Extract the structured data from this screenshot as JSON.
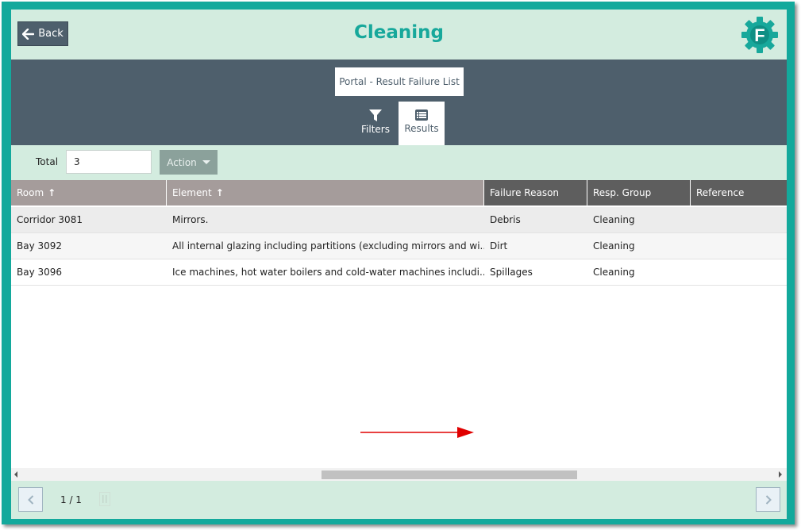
{
  "header": {
    "back_label": "Back",
    "title": "Cleaning",
    "logo_letter": "F",
    "accent_color": "#17a89b"
  },
  "portal": {
    "label": "Portal - Result Failure List"
  },
  "tabs": [
    {
      "label": "Filters",
      "icon": "filter-icon",
      "active": false
    },
    {
      "label": "Results",
      "icon": "list-icon",
      "active": true
    }
  ],
  "toolbar": {
    "total_label": "Total",
    "total_value": "3",
    "action_label": "Action"
  },
  "table": {
    "columns": [
      {
        "label": "Room",
        "sort": "asc"
      },
      {
        "label": "Element",
        "sort": "asc"
      },
      {
        "label": "Failure Reason"
      },
      {
        "label": "Resp. Group"
      },
      {
        "label": "Reference"
      }
    ],
    "rows": [
      {
        "room": "Corridor 3081",
        "element": "Mirrors.",
        "reason": "Debris",
        "group": "Cleaning",
        "reference": ""
      },
      {
        "room": "Bay 3092",
        "element": "All internal glazing including partitions (excluding mirrors and wi...",
        "reason": "Dirt",
        "group": "Cleaning",
        "reference": ""
      },
      {
        "room": "Bay 3096",
        "element": "Ice machines, hot water boilers and cold-water machines includi...",
        "reason": "Spillages",
        "group": "Cleaning",
        "reference": ""
      }
    ]
  },
  "pagination": {
    "page_text": "1 / 1"
  }
}
